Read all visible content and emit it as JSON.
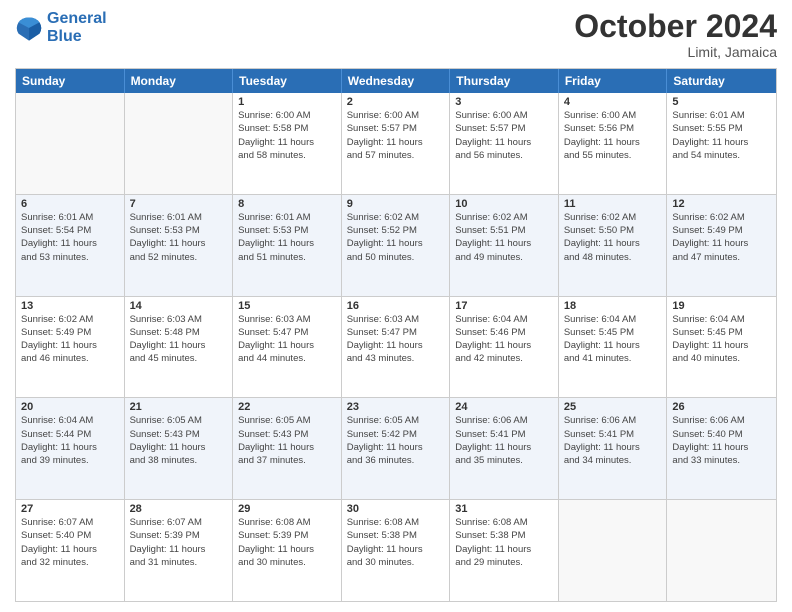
{
  "header": {
    "logo_line1": "General",
    "logo_line2": "Blue",
    "month": "October 2024",
    "location": "Limit, Jamaica"
  },
  "weekdays": [
    "Sunday",
    "Monday",
    "Tuesday",
    "Wednesday",
    "Thursday",
    "Friday",
    "Saturday"
  ],
  "rows": [
    [
      {
        "day": "",
        "info": "",
        "empty": true
      },
      {
        "day": "",
        "info": "",
        "empty": true
      },
      {
        "day": "1",
        "info": "Sunrise: 6:00 AM\nSunset: 5:58 PM\nDaylight: 11 hours\nand 58 minutes."
      },
      {
        "day": "2",
        "info": "Sunrise: 6:00 AM\nSunset: 5:57 PM\nDaylight: 11 hours\nand 57 minutes."
      },
      {
        "day": "3",
        "info": "Sunrise: 6:00 AM\nSunset: 5:57 PM\nDaylight: 11 hours\nand 56 minutes."
      },
      {
        "day": "4",
        "info": "Sunrise: 6:00 AM\nSunset: 5:56 PM\nDaylight: 11 hours\nand 55 minutes."
      },
      {
        "day": "5",
        "info": "Sunrise: 6:01 AM\nSunset: 5:55 PM\nDaylight: 11 hours\nand 54 minutes."
      }
    ],
    [
      {
        "day": "6",
        "info": "Sunrise: 6:01 AM\nSunset: 5:54 PM\nDaylight: 11 hours\nand 53 minutes."
      },
      {
        "day": "7",
        "info": "Sunrise: 6:01 AM\nSunset: 5:53 PM\nDaylight: 11 hours\nand 52 minutes."
      },
      {
        "day": "8",
        "info": "Sunrise: 6:01 AM\nSunset: 5:53 PM\nDaylight: 11 hours\nand 51 minutes."
      },
      {
        "day": "9",
        "info": "Sunrise: 6:02 AM\nSunset: 5:52 PM\nDaylight: 11 hours\nand 50 minutes."
      },
      {
        "day": "10",
        "info": "Sunrise: 6:02 AM\nSunset: 5:51 PM\nDaylight: 11 hours\nand 49 minutes."
      },
      {
        "day": "11",
        "info": "Sunrise: 6:02 AM\nSunset: 5:50 PM\nDaylight: 11 hours\nand 48 minutes."
      },
      {
        "day": "12",
        "info": "Sunrise: 6:02 AM\nSunset: 5:49 PM\nDaylight: 11 hours\nand 47 minutes."
      }
    ],
    [
      {
        "day": "13",
        "info": "Sunrise: 6:02 AM\nSunset: 5:49 PM\nDaylight: 11 hours\nand 46 minutes."
      },
      {
        "day": "14",
        "info": "Sunrise: 6:03 AM\nSunset: 5:48 PM\nDaylight: 11 hours\nand 45 minutes."
      },
      {
        "day": "15",
        "info": "Sunrise: 6:03 AM\nSunset: 5:47 PM\nDaylight: 11 hours\nand 44 minutes."
      },
      {
        "day": "16",
        "info": "Sunrise: 6:03 AM\nSunset: 5:47 PM\nDaylight: 11 hours\nand 43 minutes."
      },
      {
        "day": "17",
        "info": "Sunrise: 6:04 AM\nSunset: 5:46 PM\nDaylight: 11 hours\nand 42 minutes."
      },
      {
        "day": "18",
        "info": "Sunrise: 6:04 AM\nSunset: 5:45 PM\nDaylight: 11 hours\nand 41 minutes."
      },
      {
        "day": "19",
        "info": "Sunrise: 6:04 AM\nSunset: 5:45 PM\nDaylight: 11 hours\nand 40 minutes."
      }
    ],
    [
      {
        "day": "20",
        "info": "Sunrise: 6:04 AM\nSunset: 5:44 PM\nDaylight: 11 hours\nand 39 minutes."
      },
      {
        "day": "21",
        "info": "Sunrise: 6:05 AM\nSunset: 5:43 PM\nDaylight: 11 hours\nand 38 minutes."
      },
      {
        "day": "22",
        "info": "Sunrise: 6:05 AM\nSunset: 5:43 PM\nDaylight: 11 hours\nand 37 minutes."
      },
      {
        "day": "23",
        "info": "Sunrise: 6:05 AM\nSunset: 5:42 PM\nDaylight: 11 hours\nand 36 minutes."
      },
      {
        "day": "24",
        "info": "Sunrise: 6:06 AM\nSunset: 5:41 PM\nDaylight: 11 hours\nand 35 minutes."
      },
      {
        "day": "25",
        "info": "Sunrise: 6:06 AM\nSunset: 5:41 PM\nDaylight: 11 hours\nand 34 minutes."
      },
      {
        "day": "26",
        "info": "Sunrise: 6:06 AM\nSunset: 5:40 PM\nDaylight: 11 hours\nand 33 minutes."
      }
    ],
    [
      {
        "day": "27",
        "info": "Sunrise: 6:07 AM\nSunset: 5:40 PM\nDaylight: 11 hours\nand 32 minutes."
      },
      {
        "day": "28",
        "info": "Sunrise: 6:07 AM\nSunset: 5:39 PM\nDaylight: 11 hours\nand 31 minutes."
      },
      {
        "day": "29",
        "info": "Sunrise: 6:08 AM\nSunset: 5:39 PM\nDaylight: 11 hours\nand 30 minutes."
      },
      {
        "day": "30",
        "info": "Sunrise: 6:08 AM\nSunset: 5:38 PM\nDaylight: 11 hours\nand 30 minutes."
      },
      {
        "day": "31",
        "info": "Sunrise: 6:08 AM\nSunset: 5:38 PM\nDaylight: 11 hours\nand 29 minutes."
      },
      {
        "day": "",
        "info": "",
        "empty": true
      },
      {
        "day": "",
        "info": "",
        "empty": true
      }
    ]
  ]
}
